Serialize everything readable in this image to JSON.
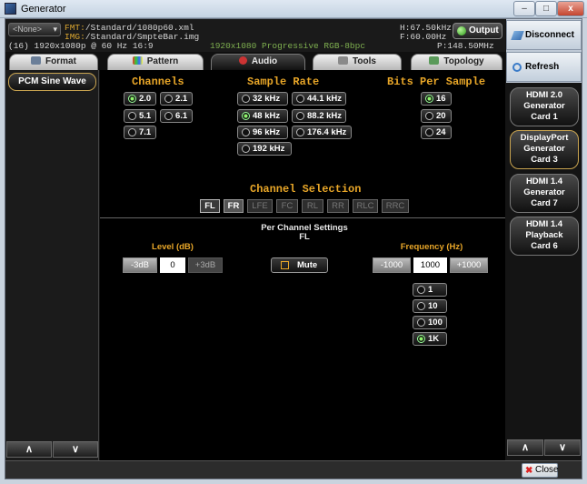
{
  "window": {
    "title": "Generator",
    "minimize": "–",
    "maximize": "□",
    "close": "x"
  },
  "header": {
    "format_dropdown": "<None>",
    "fmt_key": "FMT:",
    "fmt_value": "/Standard/1080p60.xml",
    "img_key": "IMG:",
    "img_value": "/Standard/SmpteBar.img",
    "resolution_line": "(16) 1920x1080p @ 60 Hz 16:9",
    "mode_line": "1920x1080  Progressive  RGB-8bpc",
    "hfreq": "H:67.50kHz",
    "vfreq": "F:60.00Hz",
    "pclk": "P:148.50MHz",
    "output_label": "Output"
  },
  "tabs": [
    {
      "label": "Format",
      "icon": "monitor-icon"
    },
    {
      "label": "Pattern",
      "icon": "pattern-icon"
    },
    {
      "label": "Audio",
      "icon": "speaker-icon"
    },
    {
      "label": "Tools",
      "icon": "tools-icon"
    },
    {
      "label": "Topology",
      "icon": "topology-icon"
    }
  ],
  "left_panel": {
    "selected_item": "PCM Sine Wave",
    "up": "∧",
    "down": "∨"
  },
  "audio": {
    "channels_title": "Channels",
    "channels": [
      "2.0",
      "2.1",
      "5.1",
      "6.1",
      "7.1"
    ],
    "channels_selected": "2.0",
    "sample_rate_title": "Sample Rate",
    "sample_rates": [
      "32 kHz",
      "44.1 kHz",
      "48 kHz",
      "88.2 kHz",
      "96 kHz",
      "176.4 kHz",
      "192 kHz"
    ],
    "sample_rate_selected": "48 kHz",
    "bits_title": "Bits Per Sample",
    "bits": [
      "16",
      "20",
      "24"
    ],
    "bits_selected": "16",
    "channel_selection_title": "Channel Selection",
    "channel_chips": [
      "FL",
      "FR",
      "LFE",
      "FC",
      "RL",
      "RR",
      "RLC",
      "RRC"
    ],
    "per_channel_title": "Per Channel Settings",
    "per_channel_name": "FL",
    "level_label": "Level (dB)",
    "level_minus": "-3dB",
    "level_value": "0",
    "level_plus": "+3dB",
    "mute_label": "Mute",
    "freq_label": "Frequency (Hz)",
    "freq_minus": "-1000",
    "freq_value": "1000",
    "freq_plus": "+1000",
    "freq_steps": [
      "1",
      "10",
      "100",
      "1K"
    ],
    "freq_step_selected": "1K"
  },
  "right_panel": {
    "disconnect": "Disconnect",
    "refresh": "Refresh",
    "cards": [
      {
        "l1": "HDMI 2.0",
        "l2": "Generator",
        "l3": "Card 1"
      },
      {
        "l1": "DisplayPort",
        "l2": "Generator",
        "l3": "Card 3"
      },
      {
        "l1": "HDMI 1.4",
        "l2": "Generator",
        "l3": "Card 7"
      },
      {
        "l1": "HDMI 1.4",
        "l2": "Playback",
        "l3": "Card 6"
      }
    ],
    "up": "∧",
    "down": "∨"
  },
  "bottom": {
    "close_label": "Close"
  },
  "colors": {
    "accent_orange": "#e8a628",
    "selected_green": "#8ef36b",
    "panel_black": "#000000"
  }
}
